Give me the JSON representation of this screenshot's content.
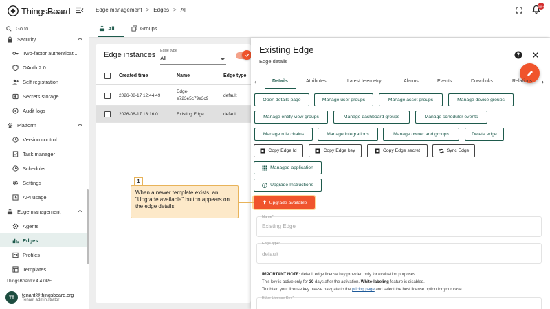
{
  "app": {
    "logo_text": "ThingsBoard",
    "logo_sub": "Professional",
    "search_placeholder": "Go to...",
    "version": "ThingsBoard v.4.4.0PE"
  },
  "sidebar": {
    "items": [
      {
        "label": "Security",
        "icon": "lock-icon",
        "level": "top"
      },
      {
        "label": "Two-factor authenticati...",
        "icon": "key-icon",
        "level": "sub"
      },
      {
        "label": "OAuth 2.0",
        "icon": "shield-icon",
        "level": "sub"
      },
      {
        "label": "Self registration",
        "icon": "person-add-icon",
        "level": "sub"
      },
      {
        "label": "Secrets storage",
        "icon": "vault-icon",
        "level": "sub"
      },
      {
        "label": "Audit logs",
        "icon": "track-changes-icon",
        "level": "sub"
      },
      {
        "label": "Platform",
        "icon": "settings-gear-icon",
        "level": "top"
      },
      {
        "label": "Version control",
        "icon": "history-icon",
        "level": "sub"
      },
      {
        "label": "Task manager",
        "icon": "task-icon",
        "level": "sub"
      },
      {
        "label": "Scheduler",
        "icon": "clock-icon",
        "level": "sub"
      },
      {
        "label": "Settings",
        "icon": "gear-icon",
        "level": "sub"
      },
      {
        "label": "API usage",
        "icon": "api-icon",
        "level": "sub"
      },
      {
        "label": "Edge management",
        "icon": "router-icon",
        "level": "top"
      },
      {
        "label": "Agents",
        "icon": "agent-icon",
        "level": "sub"
      },
      {
        "label": "Edges",
        "icon": "bar-chart-icon",
        "level": "sub",
        "active": true
      },
      {
        "label": "Profiles",
        "icon": "profile-icon",
        "level": "sub"
      },
      {
        "label": "Templates",
        "icon": "template-icon",
        "level": "sub"
      }
    ]
  },
  "user": {
    "initials": "TT",
    "email": "tenant@thingsboard.org",
    "role": "Tenant administrator"
  },
  "topbar": {
    "breadcrumb": [
      "Edge management",
      "Edges",
      "All"
    ],
    "notification_count": "999+"
  },
  "main_tabs": [
    {
      "label": "All",
      "active": true
    },
    {
      "label": "Groups",
      "active": false
    }
  ],
  "table": {
    "title": "Edge instances",
    "filter_label": "Edge type",
    "filter_value": "All",
    "columns": [
      "Created time",
      "Name",
      "Edge type"
    ],
    "rows": [
      {
        "created": "2026-08-17 12:44:49",
        "name_line1": "Edge-",
        "name_line2": "e723e5c79e3c9",
        "type": "default",
        "selected": false
      },
      {
        "created": "2026-08-17 13:16:01",
        "name_line1": "Existing Edge",
        "name_line2": "",
        "type": "default",
        "selected": true
      }
    ]
  },
  "panel": {
    "title": "Existing Edge",
    "subtitle": "Edge details",
    "tabs": [
      "Details",
      "Attributes",
      "Latest telemetry",
      "Alarms",
      "Events",
      "Downlinks",
      "Relations"
    ],
    "buttons_row1": [
      "Open details page",
      "Manage user groups",
      "Manage asset groups",
      "Manage device groups"
    ],
    "buttons_row2": [
      "Manage entity view groups",
      "Manage dashboard groups",
      "Manage scheduler events"
    ],
    "buttons_row3": [
      "Manage rule chains",
      "Manage integrations",
      "Manage owner and groups",
      "Delete edge"
    ],
    "buttons_row4": [
      "Copy Edge Id",
      "Copy Edge key",
      "Copy Edge secret",
      "Sync Edge"
    ],
    "managed_app": "Managed application",
    "upgrade_instructions": "Upgrade Instructions",
    "upgrade_available": "Upgrade available",
    "name_label": "Name*",
    "name_value": "Existing Edge",
    "edge_type_label": "Edge type*",
    "edge_type_value": "default",
    "license_label": "Edge License Key*",
    "note_line1_bold": "IMPORTANT NOTE:",
    "note_line1": " default edge license key provided only for evaluation purposes.",
    "note_line2_a": "This key is active only for ",
    "note_line2_b": "30",
    "note_line2_c": " days after the activation. ",
    "note_line2_d": "White-labeling",
    "note_line2_e": " feature is disabled.",
    "note_line3_a": "To obtain your license key please navigate to the ",
    "note_line3_link": "pricing page",
    "note_line3_b": " and select the best license option for your case."
  },
  "callout": {
    "number": "1",
    "text": "When a newer template exists, an \"Upgrade available\" button appears on the edge details."
  },
  "colors": {
    "primary": "#1e5a4c",
    "accent": "#f0542c",
    "callout_bg": "#fde9c9"
  }
}
